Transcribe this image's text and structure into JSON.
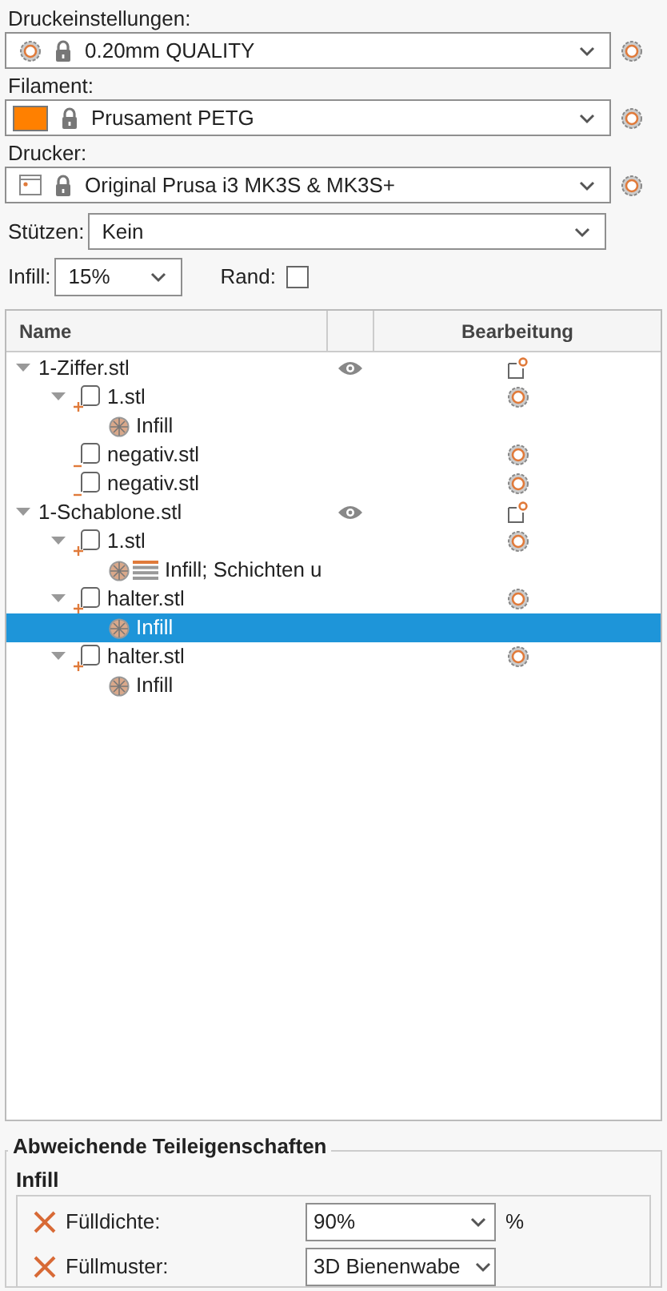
{
  "presets": [
    {
      "kind": "print",
      "label": "Druckeinstellungen:",
      "value": "0.20mm QUALITY",
      "locked": true
    },
    {
      "kind": "filament",
      "label": "Filament:",
      "value": "Prusament PETG",
      "locked": true,
      "color": "#ff8000"
    },
    {
      "kind": "printer",
      "label": "Drucker:",
      "value": "Original Prusa i3 MK3S & MK3S+",
      "locked": true
    }
  ],
  "supports": {
    "label": "Stützen:",
    "value": "Kein"
  },
  "infill": {
    "label": "Infill:",
    "value": "15%"
  },
  "brim": {
    "label": "Rand:",
    "checked": false
  },
  "tree": {
    "columns": [
      "Name",
      "Bearbeitung"
    ],
    "items": [
      {
        "kind": "object",
        "label": "1-Ziffer.stl",
        "expanded": true,
        "visible": true,
        "selected": false,
        "children": [
          {
            "kind": "part",
            "label": "1.stl",
            "expanded": true,
            "selected": false,
            "children": [
              {
                "kind": "settings",
                "label": "Infill",
                "selected": false
              }
            ]
          },
          {
            "kind": "negative",
            "label": "negativ.stl",
            "selected": false
          },
          {
            "kind": "negative",
            "label": "negativ.stl",
            "selected": false
          }
        ]
      },
      {
        "kind": "object",
        "label": "1-Schablone.stl",
        "expanded": true,
        "visible": true,
        "selected": false,
        "children": [
          {
            "kind": "part",
            "label": "1.stl",
            "expanded": true,
            "selected": false,
            "children": [
              {
                "kind": "settings-layers",
                "label": "Infill; Schichten u",
                "selected": false
              }
            ]
          },
          {
            "kind": "part",
            "label": "halter.stl",
            "expanded": true,
            "selected": false,
            "children": [
              {
                "kind": "settings",
                "label": "Infill",
                "selected": true
              }
            ]
          },
          {
            "kind": "part",
            "label": "halter.stl",
            "expanded": true,
            "selected": false,
            "children": [
              {
                "kind": "settings",
                "label": "Infill",
                "selected": false
              }
            ]
          }
        ]
      }
    ]
  },
  "overrides": {
    "title": "Abweichende Teileigenschaften",
    "group": "Infill",
    "rows": [
      {
        "label": "Fülldichte:",
        "value": "90%",
        "unit": "%"
      },
      {
        "label": "Füllmuster:",
        "value": "3D Bienenwabe"
      }
    ]
  }
}
